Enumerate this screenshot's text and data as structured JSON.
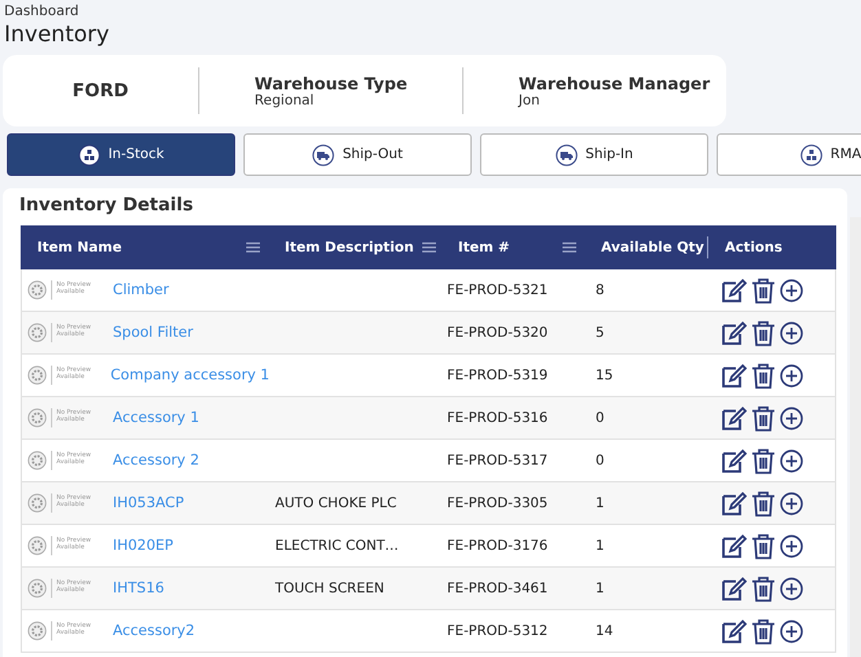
{
  "breadcrumb": "Dashboard",
  "title": "Inventory",
  "info": {
    "company": "FORD",
    "fields": [
      {
        "label": "Warehouse Type",
        "value": "Regional"
      },
      {
        "label": "Warehouse Manager",
        "value": "Jon"
      }
    ]
  },
  "tabs": [
    {
      "label": "In-Stock",
      "selected": true,
      "kind": "boxes"
    },
    {
      "label": "Ship-Out",
      "selected": false,
      "kind": "truck"
    },
    {
      "label": "Ship-In",
      "selected": false,
      "kind": "truck"
    },
    {
      "label": "RMA",
      "selected": false,
      "kind": "boxes"
    }
  ],
  "panel_title": "Inventory Details",
  "table": {
    "columns": [
      {
        "label": "Item Name",
        "menu": true
      },
      {
        "label": "Item Description",
        "menu": true
      },
      {
        "label": "Item #",
        "menu": true
      },
      {
        "label": "Available Qty",
        "menu": false
      },
      {
        "label": "Actions",
        "menu": false
      }
    ],
    "rows": [
      {
        "preview": "No Preview Available",
        "name": "Climber",
        "description": "",
        "item": "FE-PROD-5321",
        "qty": "8"
      },
      {
        "preview": "No Preview Available",
        "name": "Spool Filter",
        "description": "",
        "item": "FE-PROD-5320",
        "qty": "5"
      },
      {
        "preview": "No Preview Available",
        "name": "Company accessory 1",
        "description": "",
        "item": "FE-PROD-5319",
        "qty": "15"
      },
      {
        "preview": "No Preview Available",
        "name": "Accessory 1",
        "description": "",
        "item": "FE-PROD-5316",
        "qty": "0"
      },
      {
        "preview": "No Preview Available",
        "name": "Accessory 2",
        "description": "",
        "item": "FE-PROD-5317",
        "qty": "0"
      },
      {
        "preview": "No Preview Available",
        "name": "IH053ACP",
        "description": "AUTO CHOKE PLC",
        "item": "FE-PROD-3305",
        "qty": "1"
      },
      {
        "preview": "No Preview Available",
        "name": "IH020EP",
        "description": "ELECTRIC CONT…",
        "item": "FE-PROD-3176",
        "qty": "1"
      },
      {
        "preview": "No Preview Available",
        "name": "IHTS16",
        "description": "TOUCH SCREEN",
        "item": "FE-PROD-3461",
        "qty": "1"
      },
      {
        "preview": "No Preview Available",
        "name": "Accessory2",
        "description": "",
        "item": "FE-PROD-5312",
        "qty": "14"
      }
    ]
  }
}
